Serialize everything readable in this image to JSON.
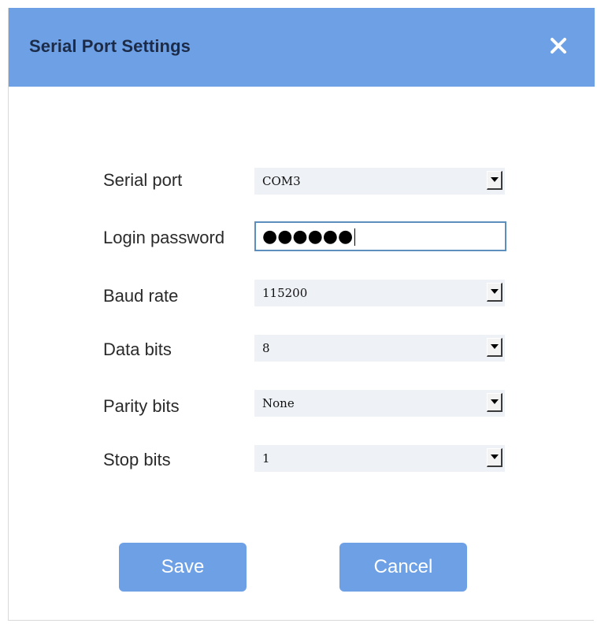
{
  "dialog": {
    "title": "Serial Port Settings",
    "close_icon": "close-icon"
  },
  "fields": {
    "serial_port": {
      "label": "Serial port",
      "value": "COM3"
    },
    "login_password": {
      "label": "Login password",
      "masked_value": "●●●●●●"
    },
    "baud_rate": {
      "label": "Baud rate",
      "value": "115200"
    },
    "data_bits": {
      "label": "Data bits",
      "value": "8"
    },
    "parity_bits": {
      "label": "Parity bits",
      "value": "None"
    },
    "stop_bits": {
      "label": "Stop bits",
      "value": "1"
    }
  },
  "buttons": {
    "save_label": "Save",
    "cancel_label": "Cancel"
  },
  "colors": {
    "accent": "#6ea0e6",
    "title_text": "#1c2c48",
    "input_border": "#5d8fbe",
    "select_bg": "#eef1f5"
  }
}
